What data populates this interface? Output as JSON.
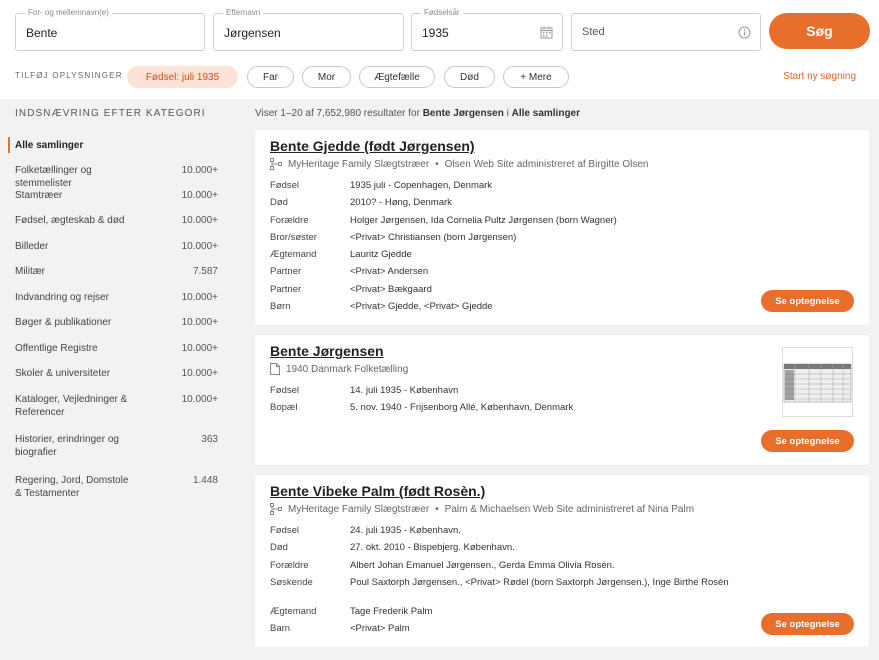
{
  "search": {
    "first": {
      "label": "For- og mellemnavn(e)",
      "value": "Bente"
    },
    "last": {
      "label": "Efternavn",
      "value": "Jørgensen"
    },
    "year": {
      "label": "Fødselsår",
      "value": "1935"
    },
    "place": {
      "placeholder": "Sted"
    },
    "button": "Søg"
  },
  "addinfo": {
    "label": "TILFØJ OPLYSNINGER",
    "chips": [
      "Fødsel: juli 1935",
      "Far",
      "Mor",
      "Ægtefælle",
      "Død",
      "+ Mere"
    ],
    "restart": "Start ny søgning"
  },
  "sidebar": {
    "title": "INDSNÆVRING EFTER KATEGORI",
    "active": "Alle samlinger",
    "items": [
      {
        "name": "Folketællinger og stemmelister",
        "count": "10.000+"
      },
      {
        "name": "Stamtræer",
        "count": "10.000+"
      },
      {
        "name": "Fødsel, ægteskab & død",
        "count": "10.000+"
      },
      {
        "name": "Billeder",
        "count": "10.000+"
      },
      {
        "name": "Militær",
        "count": "7.587"
      },
      {
        "name": "Indvandring og rejser",
        "count": "10.000+"
      },
      {
        "name": "Bøger & publikationer",
        "count": "10.000+"
      },
      {
        "name": "Offentlige Registre",
        "count": "10.000+"
      },
      {
        "name": "Skoler & universiteter",
        "count": "10.000+"
      },
      {
        "name": "Kataloger, Vejledninger & Referencer",
        "count": "10.000+"
      },
      {
        "name": "Historier, erindringer og biografier",
        "count": "363"
      },
      {
        "name": "Regering, Jord, Domstole & Testamenter",
        "count": "1.448"
      }
    ]
  },
  "results": {
    "summary_prefix": "Viser 1–20 af 7,652,980 resultater for",
    "query": "Bente Jørgensen",
    "summary_mid": "i",
    "scope": "Alle samlinger",
    "see_label": "Se optegnelse",
    "cards": [
      {
        "title": "Bente Gjedde (født Jørgensen)",
        "source": "MyHeritage Family Slægtstræer",
        "source_extra": "Olsen Web Site administreret af Birgitte Olsen",
        "rows": [
          {
            "label": "Fødsel",
            "value": "1935 juli - Copenhagen, Denmark"
          },
          {
            "label": "Død",
            "value": "2010? - Høng, Denmark"
          },
          {
            "label": "Forældre",
            "value": "Holger Jørgensen, Ida Cornelia Pultz Jørgensen (born Wagner)"
          },
          {
            "label": "Bror/søster",
            "value": "<Privat> Christiansen (born Jørgensen)"
          },
          {
            "label": "Ægtemand",
            "value": "Lauritz Gjedde"
          },
          {
            "label": "Partner",
            "value": "<Privat> Andersen"
          },
          {
            "label": "Partner",
            "value": "<Privat> Bækgaard"
          },
          {
            "label": "Børn",
            "value": "<Privat> Gjedde, <Privat> Gjedde"
          }
        ]
      },
      {
        "title": "Bente Jørgensen",
        "source": "1940 Danmark Folketælling",
        "rows": [
          {
            "label": "Fødsel",
            "value": "14. juli 1935 - København"
          },
          {
            "label": "Bopæl",
            "value": "5. nov. 1940 - Frijsenborg Allé, København, Denmark"
          }
        ]
      },
      {
        "title": "Bente Vibeke Palm (født Rosèn.)",
        "source": "MyHeritage Family Slægtstræer",
        "source_extra": "Palm & Michaelsen Web Site administreret af Nina Palm",
        "rows": [
          {
            "label": "Fødsel",
            "value": "24. juli 1935 - København."
          },
          {
            "label": "Død",
            "value": "27. okt. 2010 - Bispebjerg. København."
          },
          {
            "label": "Forældre",
            "value": "Albert Johan Emanuel Jørgensen., Gerda Emma Olivia Rosèn."
          },
          {
            "label": "Søskende",
            "value": "Poul Saxtorph Jørgensen., <Privat> Rødel (born Saxtorph Jørgensen.), Inge Birthe Rosèn"
          },
          {
            "label": "Ægtemand",
            "value": "Tage Frederik Palm"
          },
          {
            "label": "Barn",
            "value": "<Privat> Palm"
          }
        ]
      }
    ]
  },
  "colors": {
    "accent": "#e86e2c",
    "chip_active_bg": "#fde3d5",
    "body_bg": "#f2f2f2"
  }
}
